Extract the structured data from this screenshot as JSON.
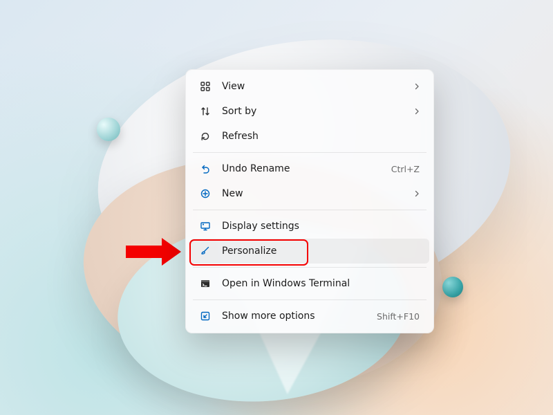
{
  "annotation": {
    "highlight_target": "personalize"
  },
  "menu": {
    "items": [
      {
        "id": "view",
        "label": "View",
        "icon": "grid-icon",
        "submenu": true
      },
      {
        "id": "sortby",
        "label": "Sort by",
        "icon": "sort-icon",
        "submenu": true
      },
      {
        "id": "refresh",
        "label": "Refresh",
        "icon": "refresh-icon"
      },
      {
        "sep": true
      },
      {
        "id": "undo",
        "label": "Undo Rename",
        "icon": "undo-icon",
        "shortcut": "Ctrl+Z",
        "blue": true
      },
      {
        "id": "new",
        "label": "New",
        "icon": "plus-icon",
        "submenu": true,
        "blue": true
      },
      {
        "sep": true
      },
      {
        "id": "display",
        "label": "Display settings",
        "icon": "display-icon",
        "blue": true
      },
      {
        "id": "personalize",
        "label": "Personalize",
        "icon": "brush-icon",
        "blue": true,
        "hover": true
      },
      {
        "sep": true
      },
      {
        "id": "terminal",
        "label": "Open in Windows Terminal",
        "icon": "terminal-icon"
      },
      {
        "sep": true
      },
      {
        "id": "moreopts",
        "label": "Show more options",
        "icon": "more-icon",
        "shortcut": "Shift+F10",
        "blue": true
      }
    ]
  }
}
